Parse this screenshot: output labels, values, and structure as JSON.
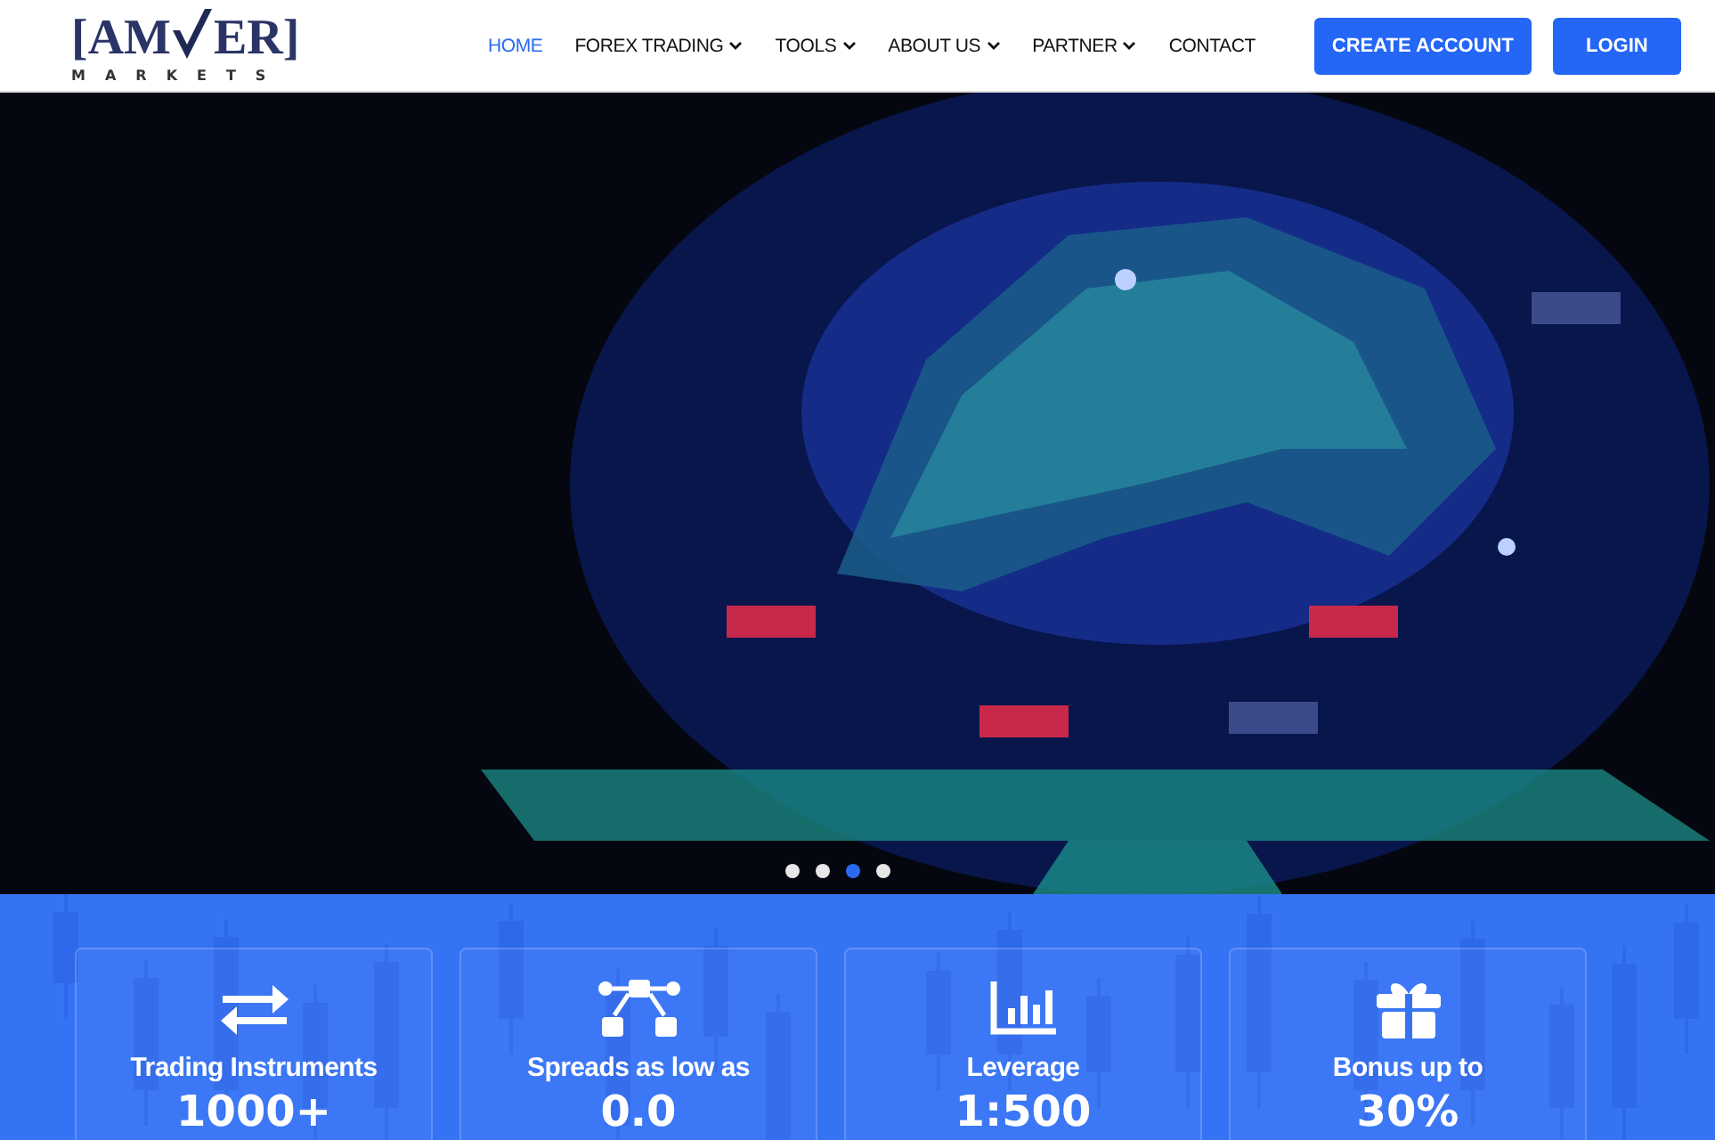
{
  "logo": {
    "left": "[AM",
    "right": "ER]",
    "tagline": "MARKETS"
  },
  "nav": [
    {
      "label": "HOME",
      "selected": true,
      "dropdown": false
    },
    {
      "label": "FOREX TRADING",
      "selected": false,
      "dropdown": true
    },
    {
      "label": "TOOLS",
      "selected": false,
      "dropdown": true
    },
    {
      "label": "ABOUT US",
      "selected": false,
      "dropdown": true
    },
    {
      "label": "PARTNER",
      "selected": false,
      "dropdown": true
    },
    {
      "label": "CONTACT",
      "selected": false,
      "dropdown": false
    }
  ],
  "buttons": [
    "CREATE ACCOUNT",
    "LOGIN"
  ],
  "hero": {
    "kind": "picture",
    "slides": [
      {
        "selected": false
      },
      {
        "selected": false
      },
      {
        "selected": true
      },
      {
        "selected": false
      }
    ]
  },
  "stats": [
    {
      "kind": "exchange",
      "label": "Trading Instruments",
      "value": "1000+"
    },
    {
      "kind": "nodes",
      "label": "Spreads as low as",
      "value": "0.0"
    },
    {
      "kind": "chart",
      "label": "Leverage",
      "value": "1:500"
    },
    {
      "kind": "gift",
      "label": "Bonus up to",
      "value": "30%"
    }
  ]
}
